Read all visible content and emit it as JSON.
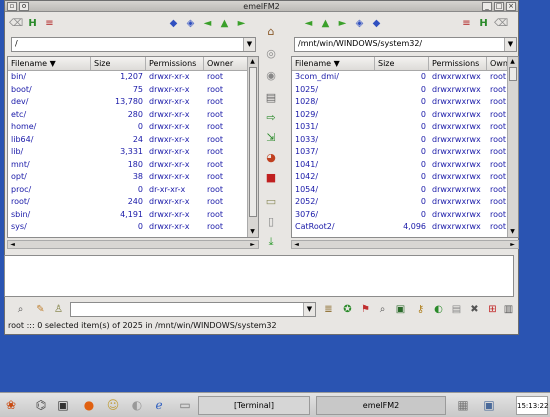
{
  "window": {
    "title": "emelFM2",
    "btn_min": "_",
    "btn_max": "□",
    "btn_close": "×"
  },
  "left_pane": {
    "path": "/",
    "headers": [
      "Filename ▼",
      "Size",
      "Permissions",
      "Owner"
    ],
    "rows": [
      {
        "name": "bin/",
        "size": "1,207",
        "perm": "drwxr-xr-x",
        "owner": "root"
      },
      {
        "name": "boot/",
        "size": "75",
        "perm": "drwxr-xr-x",
        "owner": "root"
      },
      {
        "name": "dev/",
        "size": "13,780",
        "perm": "drwxr-xr-x",
        "owner": "root"
      },
      {
        "name": "etc/",
        "size": "280",
        "perm": "drwxr-xr-x",
        "owner": "root"
      },
      {
        "name": "home/",
        "size": "0",
        "perm": "drwxr-xr-x",
        "owner": "root"
      },
      {
        "name": "lib64/",
        "size": "24",
        "perm": "drwxr-xr-x",
        "owner": "root"
      },
      {
        "name": "lib/",
        "size": "3,331",
        "perm": "drwxr-xr-x",
        "owner": "root"
      },
      {
        "name": "mnt/",
        "size": "180",
        "perm": "drwxr-xr-x",
        "owner": "root"
      },
      {
        "name": "opt/",
        "size": "38",
        "perm": "drwxr-xr-x",
        "owner": "root"
      },
      {
        "name": "proc/",
        "size": "0",
        "perm": "dr-xr-xr-x",
        "owner": "root"
      },
      {
        "name": "root/",
        "size": "240",
        "perm": "drwxr-xr-x",
        "owner": "root"
      },
      {
        "name": "sbin/",
        "size": "4,191",
        "perm": "drwxr-xr-x",
        "owner": "root"
      },
      {
        "name": "sys/",
        "size": "0",
        "perm": "drwxr-xr-x",
        "owner": "root"
      }
    ]
  },
  "right_pane": {
    "path": "/mnt/win/WINDOWS/system32/",
    "headers": [
      "Filename ▼",
      "Size",
      "Permissions",
      "Own"
    ],
    "rows": [
      {
        "name": "3com_dmi/",
        "size": "0",
        "perm": "drwxrwxrwx",
        "owner": "root"
      },
      {
        "name": "1025/",
        "size": "0",
        "perm": "drwxrwxrwx",
        "owner": "root"
      },
      {
        "name": "1028/",
        "size": "0",
        "perm": "drwxrwxrwx",
        "owner": "root"
      },
      {
        "name": "1029/",
        "size": "0",
        "perm": "drwxrwxrwx",
        "owner": "root"
      },
      {
        "name": "1031/",
        "size": "0",
        "perm": "drwxrwxrwx",
        "owner": "root"
      },
      {
        "name": "1033/",
        "size": "0",
        "perm": "drwxrwxrwx",
        "owner": "root"
      },
      {
        "name": "1037/",
        "size": "0",
        "perm": "drwxrwxrwx",
        "owner": "root"
      },
      {
        "name": "1041/",
        "size": "0",
        "perm": "drwxrwxrwx",
        "owner": "root"
      },
      {
        "name": "1042/",
        "size": "0",
        "perm": "drwxrwxrwx",
        "owner": "root"
      },
      {
        "name": "1054/",
        "size": "0",
        "perm": "drwxrwxrwx",
        "owner": "root"
      },
      {
        "name": "2052/",
        "size": "0",
        "perm": "drwxrwxrwx",
        "owner": "root"
      },
      {
        "name": "3076/",
        "size": "0",
        "perm": "drwxrwxrwx",
        "owner": "root"
      },
      {
        "name": "CatRoot2/",
        "size": "4,096",
        "perm": "drwxrwxrwx",
        "owner": "root"
      }
    ]
  },
  "status": {
    "text": "root  :::  0 selected item(s) of 2025 in /mnt/win/WINDOWS/system32"
  },
  "taskbar": {
    "terminal": "[Terminal]",
    "emelfm2": "emelFM2",
    "clock": "15:13:22"
  },
  "colors": {
    "list_text": "#1818a8",
    "desktop": "#2a54b2"
  }
}
